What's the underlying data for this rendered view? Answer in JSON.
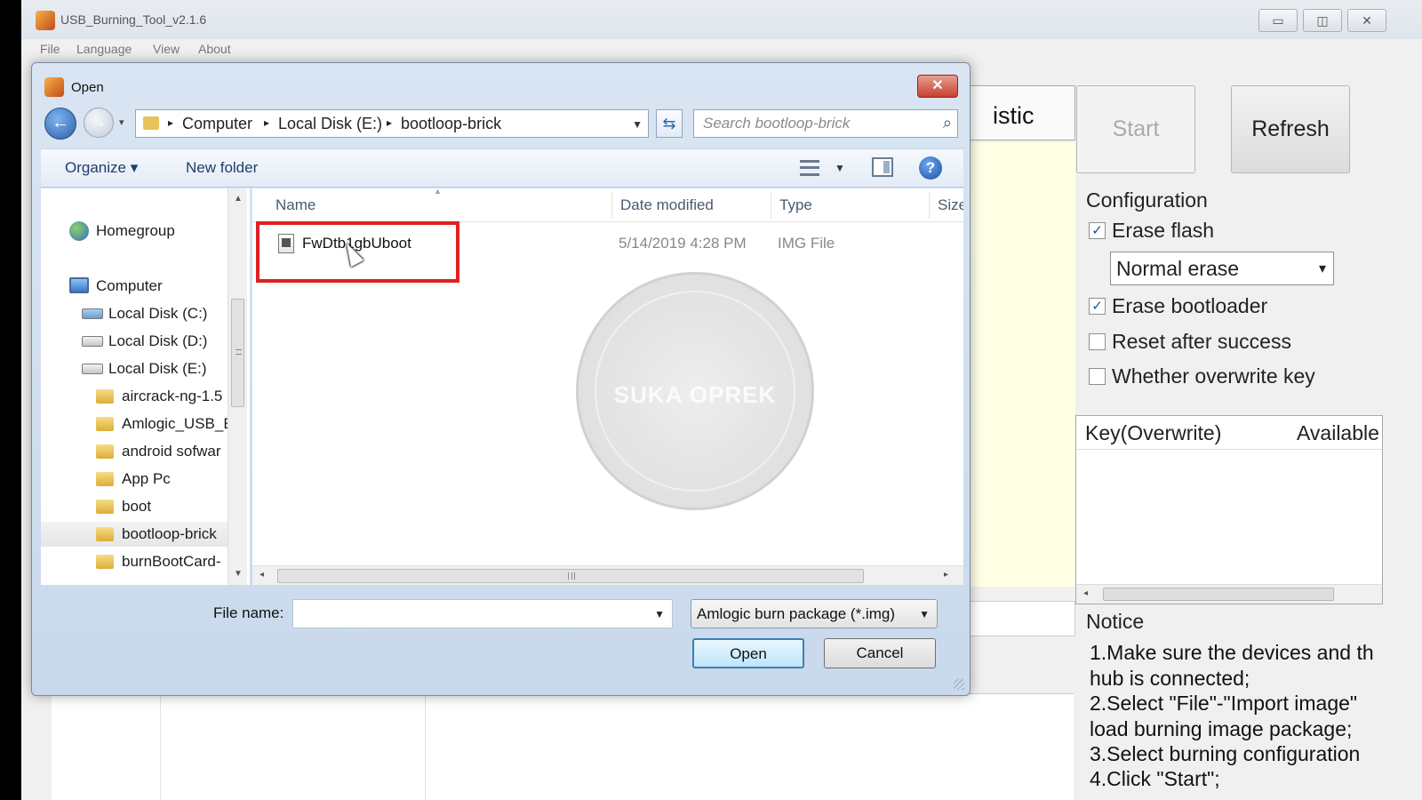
{
  "app": {
    "title": "USB_Burning_Tool_v2.1.6",
    "menu": [
      "File",
      "Language",
      "View",
      "About"
    ],
    "window_controls": {
      "minimize": "▭",
      "maximize": "◫",
      "close": "✕"
    },
    "stat_tab_label": "istic",
    "start_label": "Start",
    "refresh_label": "Refresh",
    "config_title": "Configuration",
    "erase_flash": {
      "label": "Erase flash",
      "checked": true
    },
    "erase_mode": "Normal erase",
    "erase_bootloader": {
      "label": "Erase bootloader",
      "checked": true
    },
    "reset_after_success": {
      "label": "Reset after success",
      "checked": false
    },
    "overwrite_key": {
      "label": "Whether overwrite key",
      "checked": false
    },
    "key_table": {
      "columns": [
        "Key(Overwrite)",
        "Available"
      ]
    },
    "notice_title": "Notice",
    "notice_lines": [
      "1.Make sure the devices and th",
      "hub is connected;",
      "2.Select \"File\"-\"Import image\"",
      "load burning image package;",
      "3.Select burning configuration",
      "4.Click \"Start\";"
    ]
  },
  "dialog": {
    "title": "Open",
    "close_label": "✕",
    "breadcrumb": [
      "Computer",
      "Local Disk (E:)",
      "bootloop-brick"
    ],
    "search_placeholder": "Search bootloop-brick",
    "toolbar": {
      "organize": "Organize ▾",
      "new_folder": "New folder",
      "help": "?"
    },
    "nav_items": [
      {
        "label": "Homegroup",
        "icon": "homegroup-icon"
      },
      {
        "label": "Computer",
        "icon": "computer-icon"
      },
      {
        "label": "Local Disk (C:)",
        "icon": "drive-icon"
      },
      {
        "label": "Local Disk (D:)",
        "icon": "drive-icon"
      },
      {
        "label": "Local Disk (E:)",
        "icon": "drive-icon"
      },
      {
        "label": "aircrack-ng-1.5",
        "icon": "folder-icon"
      },
      {
        "label": "Amlogic_USB_E",
        "icon": "folder-icon"
      },
      {
        "label": "android sofwar",
        "icon": "folder-icon"
      },
      {
        "label": "App Pc",
        "icon": "folder-icon"
      },
      {
        "label": "boot",
        "icon": "folder-icon"
      },
      {
        "label": "bootloop-brick",
        "icon": "folder-icon",
        "selected": true
      },
      {
        "label": "burnBootCard-",
        "icon": "folder-icon"
      }
    ],
    "columns": [
      "Name",
      "Date modified",
      "Type",
      "Size"
    ],
    "files": [
      {
        "name": "FwDtb1gbUboot",
        "date_modified": "5/14/2019 4:28 PM",
        "type": "IMG File",
        "size": ""
      }
    ],
    "watermark_text": "SUKA OPREK",
    "file_name_label": "File name:",
    "file_name_value": "",
    "file_type": "Amlogic burn package (*.img)",
    "open_label": "Open",
    "cancel_label": "Cancel",
    "highlight_color": "#e02020"
  }
}
